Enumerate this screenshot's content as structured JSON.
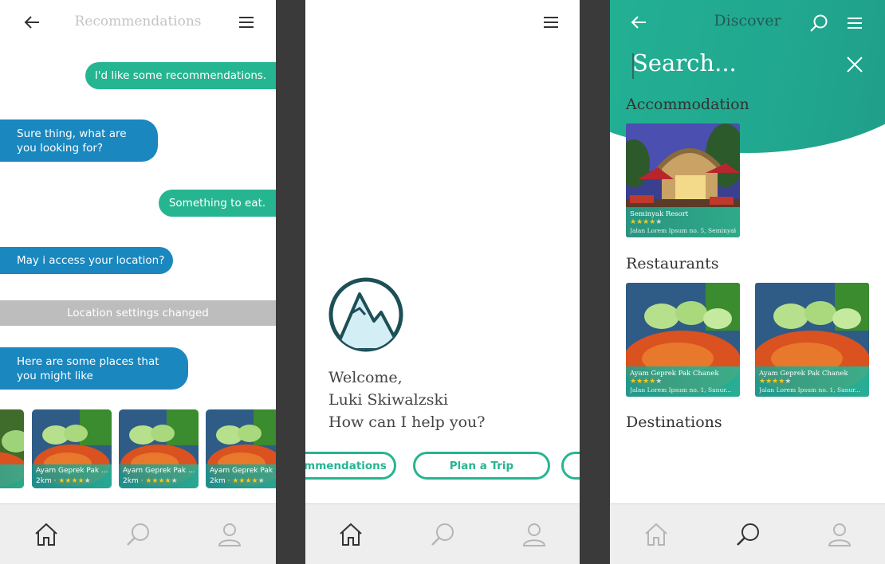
{
  "screen1": {
    "header": {
      "title": "Recommendations"
    },
    "messages": [
      {
        "from": "user",
        "text": "I'd like some recommendations."
      },
      {
        "from": "bot",
        "text": "Sure thing, what are you looking for?"
      },
      {
        "from": "user",
        "text": "Something to eat."
      },
      {
        "from": "bot",
        "text": "May i access your location?"
      },
      {
        "from": "system",
        "text": "Location settings changed"
      },
      {
        "from": "bot",
        "text": "Here are some places that you might like"
      }
    ],
    "cards": [
      {
        "name": "Ayam Geprek Pak ...",
        "distance": "2km",
        "rating": 4
      },
      {
        "name": "Ayam Geprek Pak ...",
        "distance": "2km",
        "rating": 4
      },
      {
        "name": "Ayam Geprek Pak ...",
        "distance": "2km",
        "rating": 4
      }
    ]
  },
  "screen2": {
    "welcome_line1": "Welcome,",
    "user_name": "Luki Skiwalzski",
    "prompt": "How can I help you?",
    "chips": [
      "mmendations",
      "Plan a Trip"
    ]
  },
  "screen3": {
    "header": {
      "title": "Discover"
    },
    "search": {
      "placeholder": "Search..."
    },
    "sections": {
      "accommodation": "Accommodation",
      "restaurants": "Restaurants",
      "destinations": "Destinations"
    },
    "accommodation": [
      {
        "name": "Seminyak Resort",
        "address": "Jalan Lorem Ipsum no. 5, Seminyak...",
        "rating": 4
      }
    ],
    "restaurants": [
      {
        "name": "Ayam Geprek Pak Chanek",
        "address": "Jalan Lorem Ipsum no. 1, Sanur...",
        "rating": 4
      },
      {
        "name": "Ayam Geprek Pak Chanek",
        "address": "Jalan Lorem Ipsum no. 1, Sanur...",
        "rating": 4
      }
    ]
  },
  "colors": {
    "teal": "#26b591",
    "blue": "#1a87bf",
    "gray_banner": "#bdbdbd",
    "dark_icon": "#1d4f56",
    "star": "#f7c81d"
  },
  "icons": [
    "back-arrow-icon",
    "hamburger-menu-icon",
    "home-icon",
    "search-icon",
    "profile-icon",
    "close-icon",
    "mountain-logo-icon"
  ]
}
